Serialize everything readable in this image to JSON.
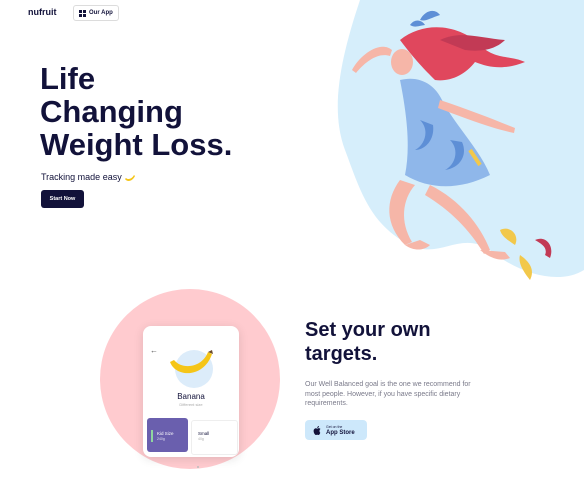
{
  "header": {
    "brand": "nufruit",
    "our_app_label": "Our App"
  },
  "hero": {
    "title_lines": [
      "Life",
      "Changing",
      "Weight Loss."
    ],
    "subtitle": "Tracking made easy",
    "cta_label": "Start Now"
  },
  "phone": {
    "fruit_name": "Banana",
    "fruit_sub": "Different size",
    "sizes": [
      {
        "label": "Kid Size",
        "weight": "240g"
      },
      {
        "label": "Small",
        "weight": "40g"
      }
    ]
  },
  "targets": {
    "title_lines": [
      "Set your own",
      "targets."
    ],
    "description": "Our Well Balanced goal is the one we recommend for most people. However, if you have specific dietary requirements.",
    "store_small": "Get on the",
    "store_big": "App Store"
  },
  "colors": {
    "navy": "#12123a",
    "light_blue": "#d6eefb",
    "pink": "#ffcbcf",
    "purple": "#6a5fae"
  }
}
